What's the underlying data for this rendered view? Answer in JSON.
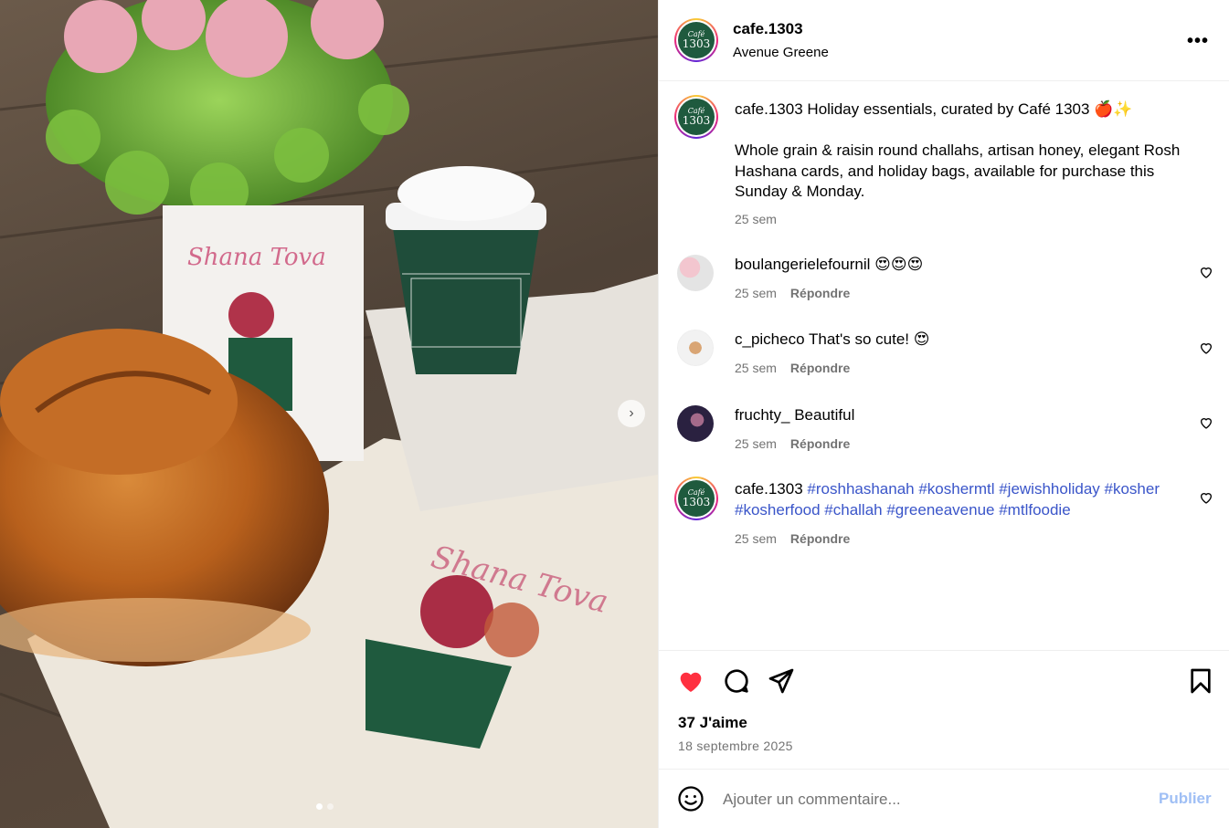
{
  "post": {
    "username": "cafe.1303",
    "location": "Avenue Greene",
    "more_icon": "more-horizontal-icon",
    "avatar_logo": {
      "line1": "Café",
      "line2": "1303"
    }
  },
  "caption": {
    "username": "cafe.1303",
    "text_line1": "Holiday essentials, curated by Café 1303 🍎✨",
    "text_body": "Whole grain & raisin round challahs, artisan honey, elegant Rosh Hashana cards, and holiday bags, available for purchase this Sunday & Monday.",
    "time": "25 sem"
  },
  "comments": [
    {
      "username": "boulangerielefournil",
      "text": "😍😍😍",
      "time": "25 sem",
      "reply": "Répondre"
    },
    {
      "username": "c_picheco",
      "text": "That's so cute! 😍",
      "time": "25 sem",
      "reply": "Répondre"
    },
    {
      "username": "fruchty_",
      "text": "Beautiful",
      "time": "25 sem",
      "reply": "Répondre"
    },
    {
      "username": "cafe.1303",
      "text": "#roshhashanah #koshermtl #jewishholiday #kosher #kosherfood #challah #greeneavenue #mtlfoodie",
      "time": "25 sem",
      "reply": "Répondre"
    }
  ],
  "actions": {
    "likes": "37 J'aime",
    "date": "18 septembre 2025",
    "like_color": "#ff3040"
  },
  "composer": {
    "placeholder": "Ajouter un commentaire...",
    "publish": "Publier"
  },
  "carousel": {
    "current": 1,
    "total": 2
  }
}
